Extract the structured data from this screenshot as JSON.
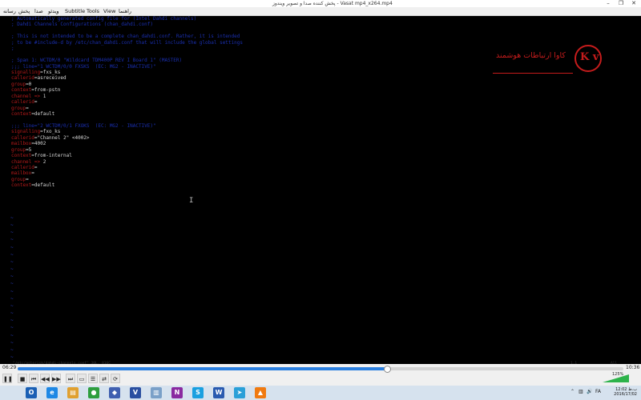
{
  "window": {
    "title": "پخش کننده صدا و تصویر ویندوز - Vasat mp4_x264.mp4",
    "controls": [
      "–",
      "❐",
      "✕"
    ]
  },
  "menu": {
    "right_items": [
      "راهنما",
      "View",
      "Tools",
      "Subtitle",
      "ویدئو",
      "صدا",
      "پخش",
      "رسانه"
    ]
  },
  "terminal": {
    "lines": [
      {
        "parts": [
          {
            "t": "; Automatically generated config file for (Intel Dahdi channels)",
            "c": "blue"
          }
        ]
      },
      {
        "parts": [
          {
            "t": "; Dahdi Channels Configurations (chan_dahdi.conf)",
            "c": "blue"
          }
        ]
      },
      {
        "parts": [
          {
            "t": "",
            "c": "blue"
          }
        ]
      },
      {
        "parts": [
          {
            "t": "; This is not intended to be a complete chan_dahdi.conf. Rather, it is intended",
            "c": "blue"
          }
        ]
      },
      {
        "parts": [
          {
            "t": "; to be #include-d by /etc/chan_dahdi.conf that will include the global settings",
            "c": "blue"
          }
        ]
      },
      {
        "parts": [
          {
            "t": ";",
            "c": "blue"
          }
        ]
      },
      {
        "parts": [
          {
            "t": "",
            "c": "blue"
          }
        ]
      },
      {
        "parts": [
          {
            "t": "; Span 1: WCTDM/0 \"Wildcard TDM400P REV I Board 1\" (MASTER)",
            "c": "blue"
          }
        ]
      },
      {
        "parts": [
          {
            "t": ";;; line=\"1 WCTDM/0/0 FXSKS  (EC: MG2 - INACTIVE)\"",
            "c": "blue"
          }
        ]
      },
      {
        "parts": [
          {
            "t": "signalling",
            "c": "red"
          },
          {
            "t": "=fxs_ks",
            "c": "white"
          }
        ]
      },
      {
        "parts": [
          {
            "t": "callerid",
            "c": "red"
          },
          {
            "t": "=asreceived",
            "c": "white"
          }
        ]
      },
      {
        "parts": [
          {
            "t": "group",
            "c": "red"
          },
          {
            "t": "=0",
            "c": "white"
          }
        ]
      },
      {
        "parts": [
          {
            "t": "context",
            "c": "red"
          },
          {
            "t": "=from-pstn",
            "c": "white"
          }
        ]
      },
      {
        "parts": [
          {
            "t": "channel => ",
            "c": "red"
          },
          {
            "t": "1",
            "c": "white"
          }
        ]
      },
      {
        "parts": [
          {
            "t": "callerid",
            "c": "red"
          },
          {
            "t": "=",
            "c": "white"
          }
        ]
      },
      {
        "parts": [
          {
            "t": "group",
            "c": "red"
          },
          {
            "t": "=",
            "c": "white"
          }
        ]
      },
      {
        "parts": [
          {
            "t": "context",
            "c": "red"
          },
          {
            "t": "=default",
            "c": "white"
          }
        ]
      },
      {
        "parts": [
          {
            "t": "",
            "c": "white"
          }
        ]
      },
      {
        "parts": [
          {
            "t": ";;; line=\"2 WCTDM/0/1 FXOKS  (EC: MG2 - INACTIVE)\"",
            "c": "blue"
          }
        ]
      },
      {
        "parts": [
          {
            "t": "signalling",
            "c": "red"
          },
          {
            "t": "=fxo_ks",
            "c": "white"
          }
        ]
      },
      {
        "parts": [
          {
            "t": "callerid",
            "c": "red"
          },
          {
            "t": "=\"Channel 2\" <4002>",
            "c": "white"
          }
        ]
      },
      {
        "parts": [
          {
            "t": "mailbox",
            "c": "red"
          },
          {
            "t": "=4002",
            "c": "white"
          }
        ]
      },
      {
        "parts": [
          {
            "t": "group",
            "c": "red"
          },
          {
            "t": "=5",
            "c": "white"
          }
        ]
      },
      {
        "parts": [
          {
            "t": "context",
            "c": "red"
          },
          {
            "t": "=from-internal",
            "c": "white"
          }
        ]
      },
      {
        "parts": [
          {
            "t": "channel => ",
            "c": "red"
          },
          {
            "t": "2",
            "c": "white"
          }
        ]
      },
      {
        "parts": [
          {
            "t": "callerid",
            "c": "red"
          },
          {
            "t": "=",
            "c": "white"
          }
        ]
      },
      {
        "parts": [
          {
            "t": "mailbox",
            "c": "red"
          },
          {
            "t": "=",
            "c": "white"
          }
        ]
      },
      {
        "parts": [
          {
            "t": "group",
            "c": "red"
          },
          {
            "t": "=",
            "c": "white"
          }
        ]
      },
      {
        "parts": [
          {
            "t": "context",
            "c": "red"
          },
          {
            "t": "=default",
            "c": "white"
          }
        ]
      }
    ],
    "tilde_count": 20,
    "status_left": "\"/etc/asterisk/dahdi-channels.conf\" 30L, 816C",
    "status_right": "1,1",
    "status_all": "All"
  },
  "logo": {
    "letters": "K v",
    "text": "کاوا ارتباطات هوشمند"
  },
  "player": {
    "time_elapsed": "06:29",
    "time_total": "10:36",
    "progress_fraction": 0.61,
    "volume_percent": "125%",
    "buttons": [
      "❚❚",
      "■",
      "⏮",
      "◀◀",
      "▶▶",
      "⏭",
      "▭",
      "☰",
      "⇄",
      "⟳"
    ]
  },
  "taskbar": {
    "clock_time": "12:02 ب.ظ",
    "clock_date": "2016/17/02",
    "apps": [
      {
        "label": "O",
        "color": "#1a5fb4"
      },
      {
        "label": "e",
        "color": "#1e88e5"
      },
      {
        "label": "▤",
        "color": "#e0a030"
      },
      {
        "label": "●",
        "color": "#2e9e3e"
      },
      {
        "label": "◆",
        "color": "#3f5fb0"
      },
      {
        "label": "V",
        "color": "#2a4fa0"
      },
      {
        "label": "▥",
        "color": "#7aa0c8"
      },
      {
        "label": "N",
        "color": "#8a2aa0"
      },
      {
        "label": "S",
        "color": "#1aa0e0"
      },
      {
        "label": "W",
        "color": "#2a5bb0"
      },
      {
        "label": "➤",
        "color": "#2aa0d8"
      },
      {
        "label": "▲",
        "color": "#f07a10"
      }
    ]
  }
}
